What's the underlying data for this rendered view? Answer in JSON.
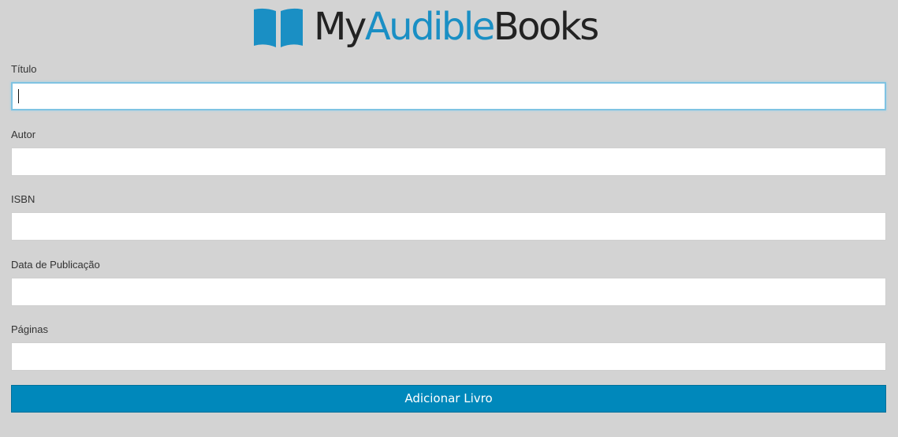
{
  "brand": {
    "part1": "My",
    "part2": "Audible",
    "part3": "Books",
    "accent_color": "#1a8fc4",
    "icon": "open-book-icon"
  },
  "form": {
    "fields": [
      {
        "label": "Título",
        "value": "",
        "focused": true
      },
      {
        "label": "Autor",
        "value": ""
      },
      {
        "label": "ISBN",
        "value": ""
      },
      {
        "label": "Data de Publicação",
        "value": ""
      },
      {
        "label": "Páginas",
        "value": ""
      }
    ],
    "submit_label": "Adicionar Livro",
    "submit_color": "#0088bb"
  }
}
